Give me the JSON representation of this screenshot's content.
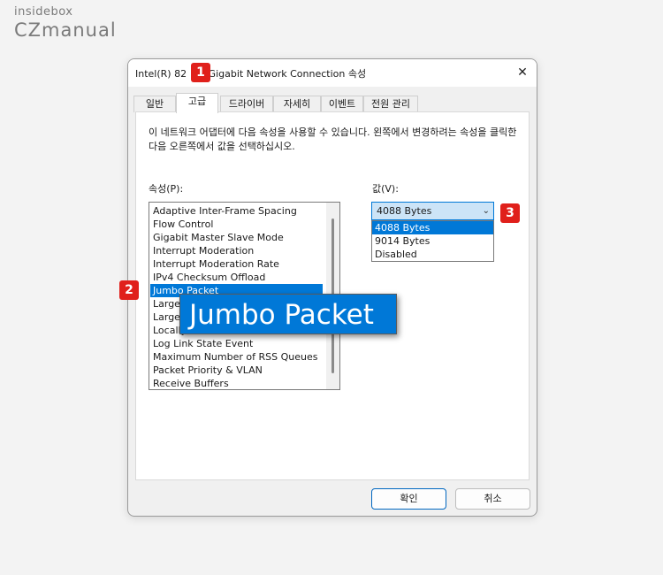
{
  "brand": {
    "top": "insidebox",
    "bottom": "CZmanual"
  },
  "dialog": {
    "title": "Intel(R) 82       Gigabit Network Connection 속성",
    "close_icon": "✕",
    "tabs": [
      "일반",
      "고급",
      "드라이버",
      "자세히",
      "이벤트",
      "전원 관리"
    ],
    "active_tab": "고급",
    "description": "이 네트워크 어댑터에 다음 속성을 사용할 수 있습니다. 왼쪽에서 변경하려는 속성을 클릭한 다음 오른쪽에서 값을 선택하십시오.",
    "property_label": "속성(P):",
    "value_label": "값(V):",
    "properties": [
      "Adaptive Inter-Frame Spacing",
      "Flow Control",
      "Gigabit Master Slave Mode",
      "Interrupt Moderation",
      "Interrupt Moderation Rate",
      "IPv4 Checksum Offload",
      "Jumbo Packet",
      "Large",
      "Large",
      "Locally",
      "Log Link State Event",
      "Maximum Number of RSS Queues",
      "Packet Priority & VLAN",
      "Receive Buffers"
    ],
    "selected_property": "Jumbo Packet",
    "value_selected": "4088 Bytes",
    "value_options": [
      "4088 Bytes",
      "9014 Bytes",
      "Disabled"
    ],
    "ok_label": "확인",
    "cancel_label": "취소"
  },
  "markers": [
    "1",
    "2",
    "3"
  ],
  "zoom_callout": "Jumbo Packet",
  "colors": {
    "accent": "#0078d7",
    "marker": "#e0201b"
  },
  "icons": {
    "close": "close-icon",
    "dropdown": "chevron-down-icon"
  }
}
